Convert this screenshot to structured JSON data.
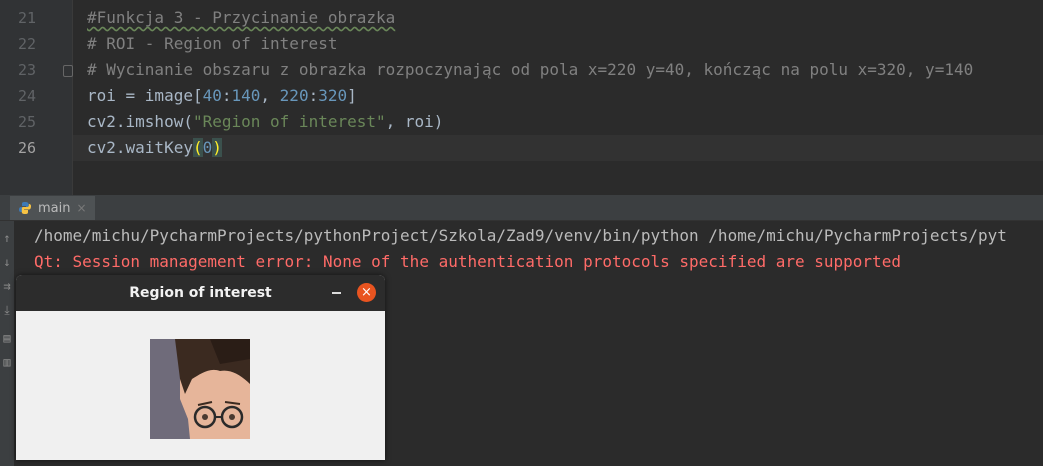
{
  "editor": {
    "lines": [
      {
        "num": "21",
        "text": "#Funkcja 3 - Przycinanie obrazka"
      },
      {
        "num": "22",
        "text": "# ROI - Region of interest"
      },
      {
        "num": "23",
        "text": "# Wycinanie obszaru z obrazka rozpoczynając od pola x=220 y=40, kończąc na polu x=320, y=140"
      },
      {
        "num": "24",
        "parts": [
          "roi = image[",
          "40",
          ":",
          "140",
          ", ",
          "220",
          ":",
          "320",
          "]"
        ]
      },
      {
        "num": "25",
        "parts": [
          "cv2.imshow(",
          "\"Region of interest\"",
          ", roi)"
        ]
      },
      {
        "num": "26",
        "parts": [
          "cv2.waitKey",
          "(",
          "0",
          ")"
        ]
      }
    ],
    "current_line": "26"
  },
  "run_panel": {
    "tab_label": "main",
    "tab_close": "×",
    "console_lines": [
      {
        "type": "std",
        "text": "/home/michu/PycharmProjects/pythonProject/Szkola/Zad9/venv/bin/python /home/michu/PycharmProjects/pyt"
      },
      {
        "type": "err",
        "text": "Qt: Session management error: None of the authentication protocols specified are supported"
      }
    ]
  },
  "window": {
    "title": "Region of interest",
    "close_glyph": "×"
  },
  "colors": {
    "editor_bg": "#2b2b2b",
    "comment": "#808080",
    "number": "#6897bb",
    "string": "#6a8759",
    "error": "#ff6b68",
    "ubuntu_close": "#e95420"
  },
  "icons": [
    "python-icon",
    "arrow-up-icon",
    "arrow-down-icon",
    "soft-wrap-icon",
    "scroll-to-end-icon",
    "print-icon",
    "trash-icon",
    "fold-icon",
    "minimize-icon",
    "close-icon"
  ]
}
